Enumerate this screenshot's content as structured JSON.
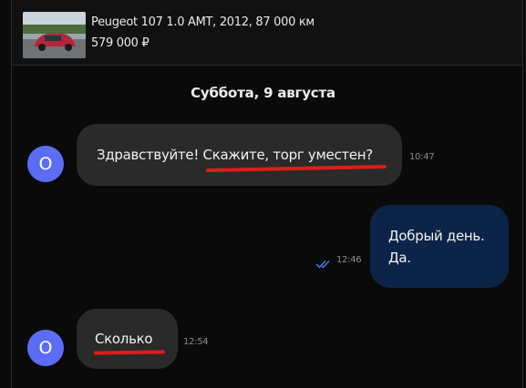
{
  "listing": {
    "title": "Peugeot 107 1.0 AMT, 2012, 87 000 км",
    "price": "579 000 ₽"
  },
  "chat": {
    "date_label": "Суббота, 9 августа",
    "messages": [
      {
        "direction": "incoming",
        "avatar_letter": "О",
        "text_plain": "Здравствуйте! ",
        "text_highlighted": "Скажите, торг уместен?",
        "time": "10:47"
      },
      {
        "direction": "outgoing",
        "line1": "Добрый день.",
        "line2": "Да.",
        "time": "12:46",
        "status_icon": "double-check-icon"
      },
      {
        "direction": "incoming",
        "avatar_letter": "О",
        "text_highlighted": "Сколько",
        "time": "12:54"
      }
    ]
  },
  "colors": {
    "background": "#0a0a0a",
    "incoming_bubble": "#2a2a2a",
    "outgoing_bubble": "#0c2447",
    "avatar": "#5b6cf6",
    "read_check": "#3b82f6",
    "annotation_underline": "#e01b1b"
  }
}
